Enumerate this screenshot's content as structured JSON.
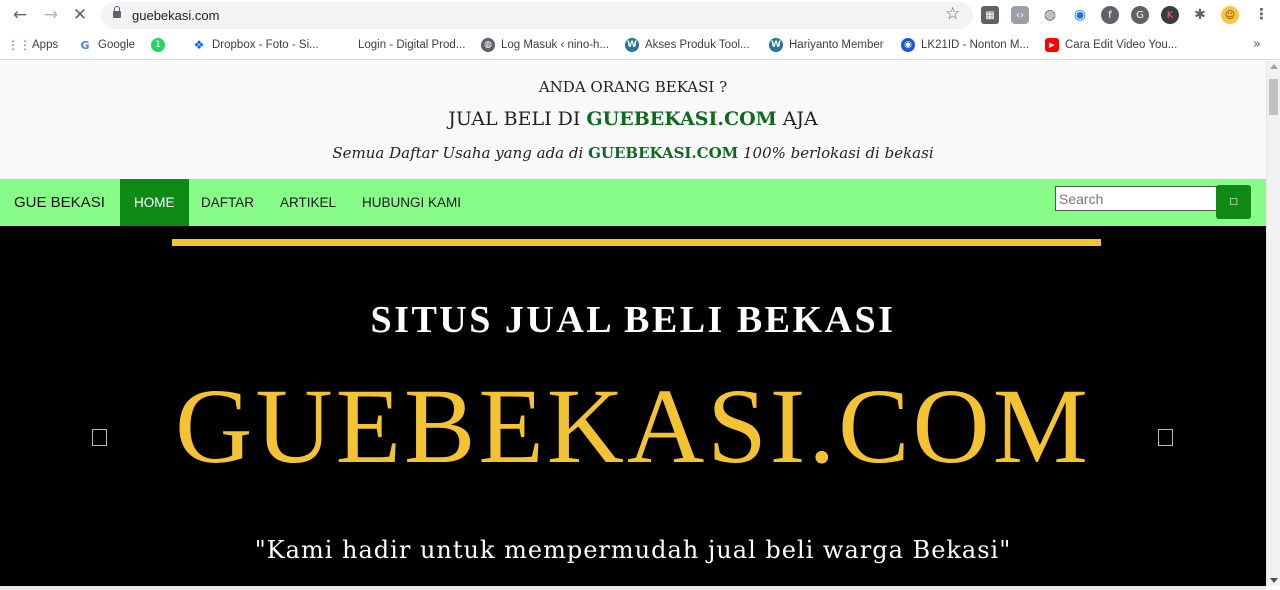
{
  "browser": {
    "url": "guebekasi.com",
    "bookmarks": [
      {
        "label": "Apps",
        "icon": "apps-grid-icon",
        "color": "#1a73e8"
      },
      {
        "label": "Google",
        "icon": "google-icon",
        "color": "#4285f4"
      },
      {
        "label": "",
        "icon": "whatsapp-icon",
        "color": "#25d366"
      },
      {
        "label": "Dropbox - Foto - Si...",
        "icon": "dropbox-icon",
        "color": "#0061ff"
      },
      {
        "label": "Login - Digital Prod...",
        "icon": "blank-page-icon",
        "color": "#ffffff"
      },
      {
        "label": "Log Masuk ‹ nino-h...",
        "icon": "globe-icon",
        "color": "#5f6368"
      },
      {
        "label": "Akses Produk Tool...",
        "icon": "wordpress-icon",
        "color": "#21759b"
      },
      {
        "label": "Hariyanto Member",
        "icon": "wordpress-icon",
        "color": "#21759b"
      },
      {
        "label": "LK21ID - Nonton M...",
        "icon": "lk21-icon",
        "color": "#1a56db"
      },
      {
        "label": "Cara Edit Video You...",
        "icon": "youtube-icon",
        "color": "#ff0000"
      }
    ]
  },
  "header": {
    "line1": "ANDA ORANG BEKASI ?",
    "line2_pre": "JUAL BELI DI ",
    "line2_brand": "GUEBEKASI.COM",
    "line2_post": " AJA",
    "line3_pre": "Semua Daftar Usaha yang ada di ",
    "line3_brand": "GUEBEKASI.COM",
    "line3_post": " 100% berlokasi di bekasi"
  },
  "navbar": {
    "brand": "GUE BEKASI",
    "items": [
      "HOME",
      "DAFTAR",
      "ARTIKEL",
      "HUBUNGI KAMI"
    ],
    "active": "HOME",
    "search_placeholder": "Search",
    "accent": "#0f8a16",
    "background": "#88fc88"
  },
  "hero": {
    "subtitle": "SITUS JUAL BELI BEKASI",
    "title": "GUEBEKASI.COM",
    "quote": "\"Kami hadir untuk mempermudah jual beli warga Bekasi\"",
    "title_color": "#f4c334"
  }
}
